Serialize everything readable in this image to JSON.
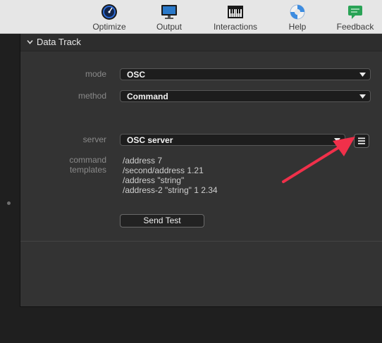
{
  "toolbar": {
    "items": [
      {
        "label": "Optimize",
        "icon": "speedometer-icon"
      },
      {
        "label": "Output",
        "icon": "monitor-icon"
      },
      {
        "label": "Interactions",
        "icon": "piano-keys-icon"
      },
      {
        "label": "Help",
        "icon": "lifebuoy-icon"
      },
      {
        "label": "Feedback",
        "icon": "chat-bubble-icon"
      }
    ]
  },
  "panel": {
    "title": "Data Track",
    "mode": {
      "label": "mode",
      "value": "OSC"
    },
    "method": {
      "label": "method",
      "value": "Command"
    },
    "server": {
      "label": "server",
      "value": "OSC server"
    },
    "templates": {
      "label_line1": "command",
      "label_line2": "templates",
      "lines": [
        "/address 7",
        "/second/address 1.21",
        "/address \"string\"",
        "/address-2 \"string\" 1 2.34"
      ]
    },
    "send_button": "Send Test"
  },
  "colors": {
    "annotation_arrow": "#f0304a",
    "panel_bg": "#333333",
    "toolbar_bg": "#e6e6e6"
  }
}
